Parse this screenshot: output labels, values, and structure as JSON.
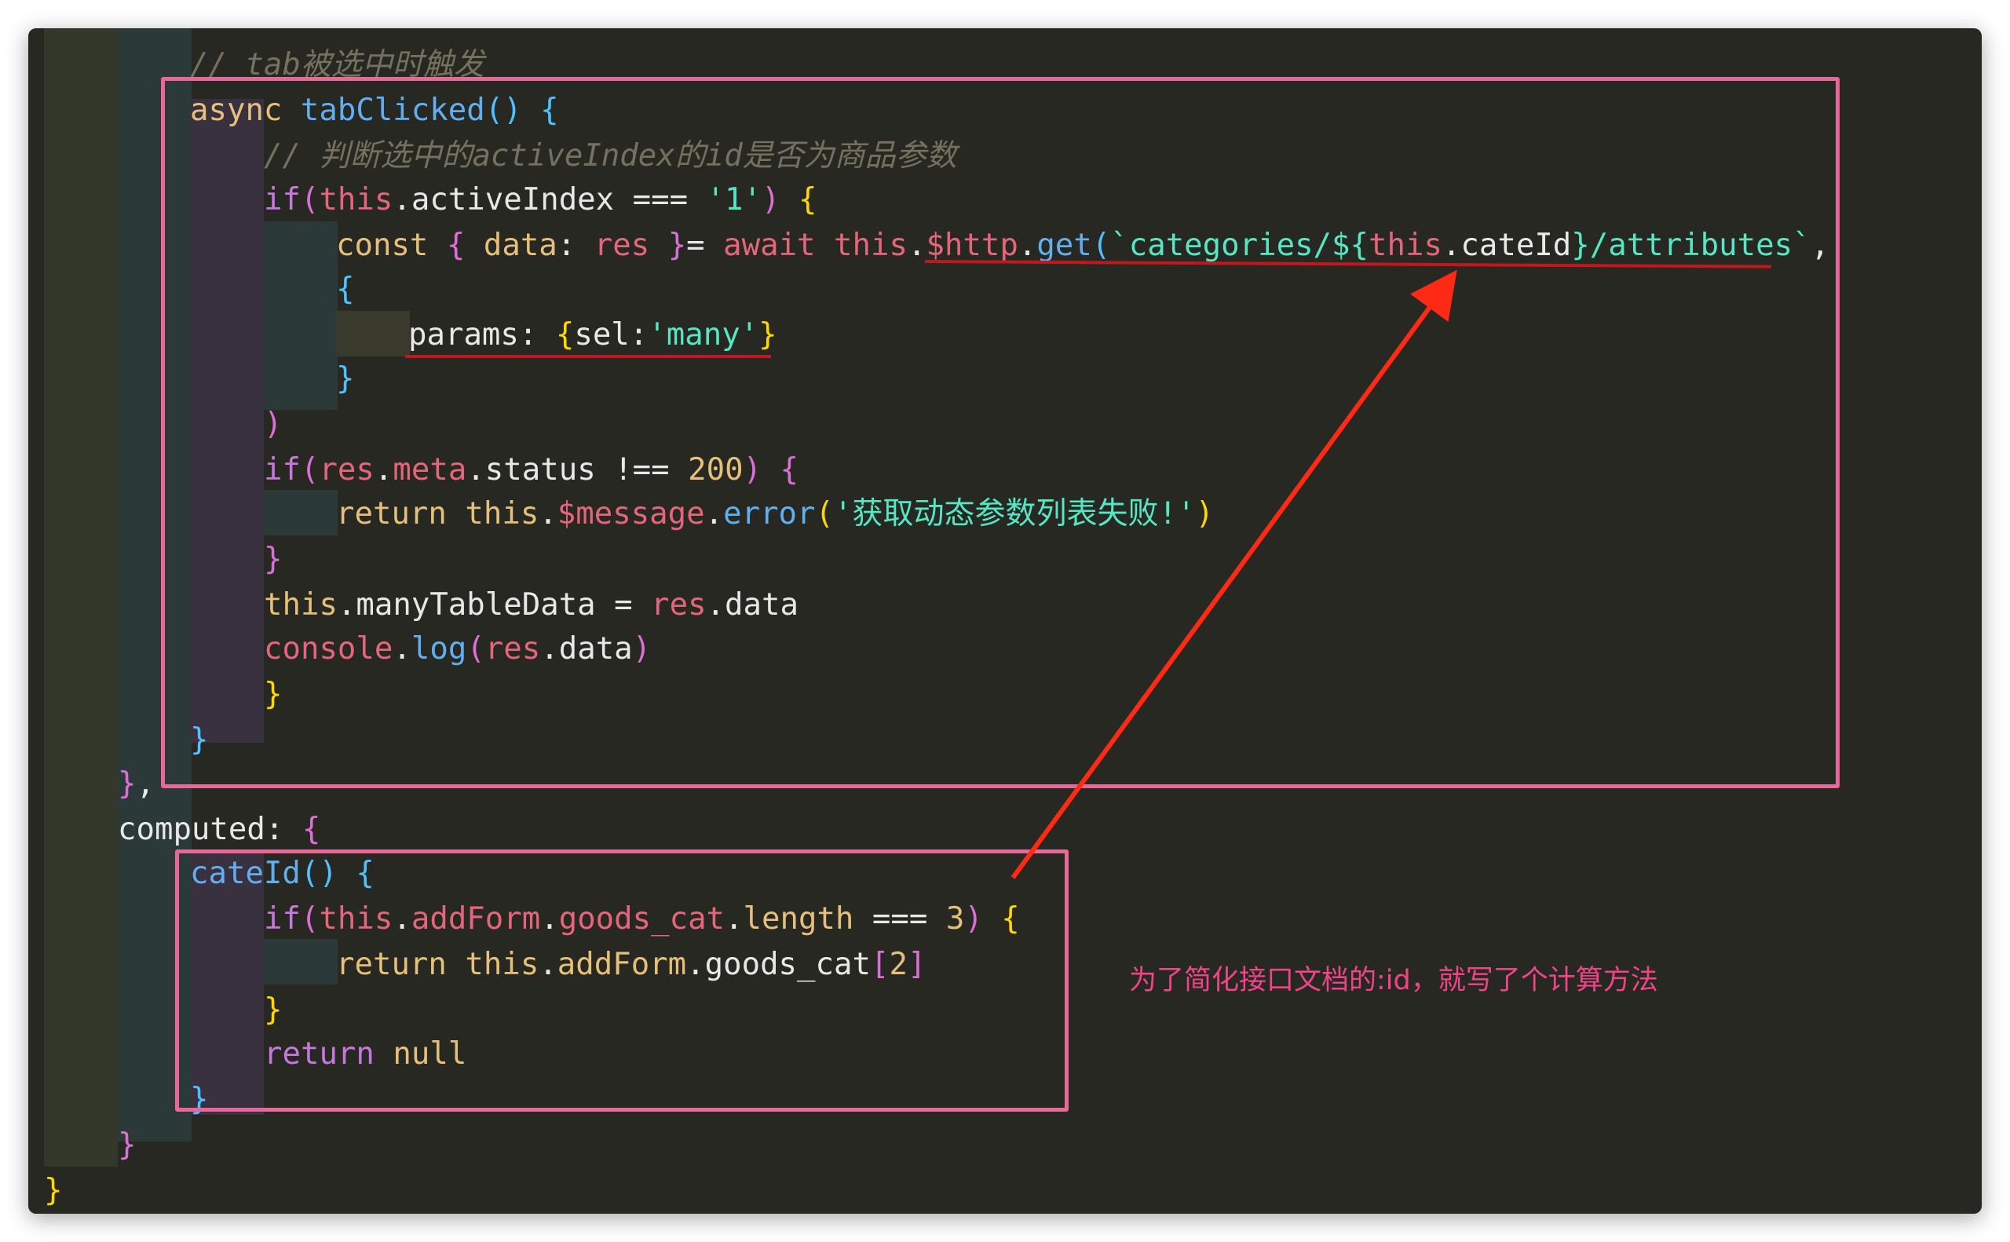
{
  "code": {
    "comment": "// tab被选中时触发",
    "method_kw": "async",
    "method_name": "tabClicked",
    "comment2": "// 判断选中的activeIndex的id是否为商品参数",
    "if_kw": "if",
    "this": "this",
    "activeIndex": "activeIndex",
    "strict_eq": "===",
    "str_1": "'1'",
    "const_kw": "const",
    "data_key": "data",
    "res": "res",
    "await_kw": "await",
    "http": "$http",
    "get": "get",
    "template_start": "`categories/${",
    "cateId": "cateId",
    "template_end": "}/attributes`",
    "params_key": "params",
    "sel_key": "sel",
    "str_many": "'many'",
    "meta": "meta",
    "status": "status",
    "not_eq": "!==",
    "num_200": "200",
    "return_kw": "return",
    "message": "$message",
    "error": "error",
    "error_msg": "'获取动态参数列表失败!'",
    "manyTableData": "manyTableData",
    "console": "console",
    "log": "log",
    "computed_key": "computed",
    "addForm": "addForm",
    "goods_cat": "goods_cat",
    "length": "length",
    "num_3": "3",
    "num_2": "2",
    "null_kw": "null"
  },
  "annotation": {
    "note": "为了简化接口文档的:id，就写了个计算方法"
  },
  "colors": {
    "background": "#272822",
    "highlight_box": "#e8689a",
    "arrow": "#ff2a14",
    "underline": "#c0181d"
  }
}
